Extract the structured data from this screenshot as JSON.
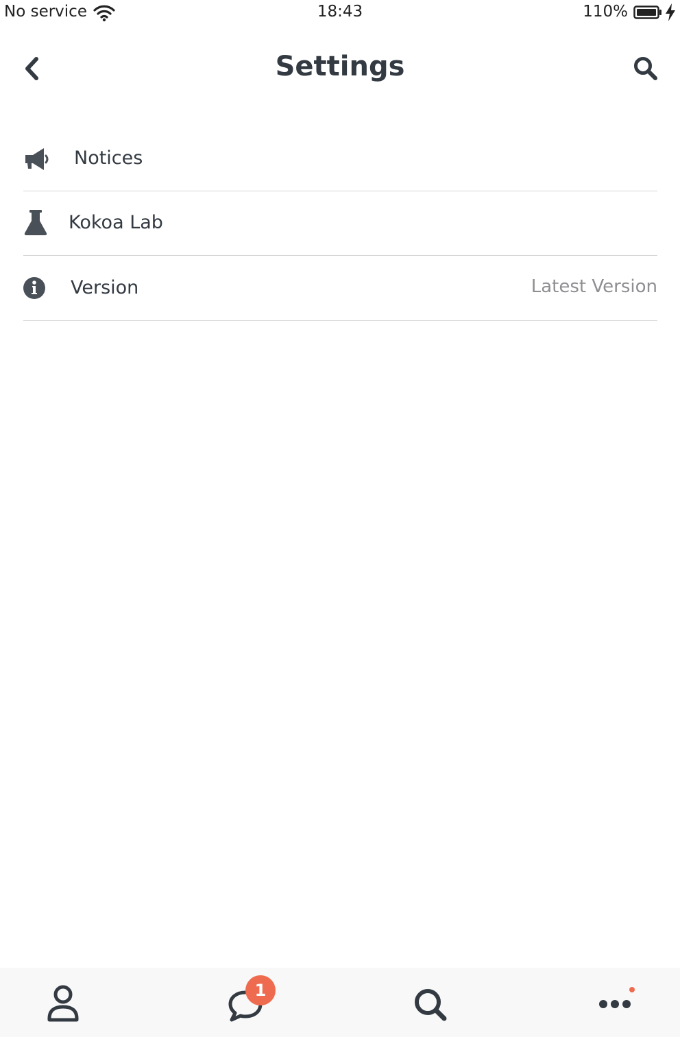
{
  "status_bar": {
    "carrier": "No service",
    "time": "18:43",
    "battery_percent": "110%",
    "icons": [
      "wifi-icon",
      "battery-icon",
      "charging-bolt-icon"
    ]
  },
  "nav": {
    "title": "Settings",
    "back_icon": "chevron-left-icon",
    "search_icon": "search-icon"
  },
  "settings": {
    "items": [
      {
        "icon": "megaphone-icon",
        "label": "Notices",
        "value": ""
      },
      {
        "icon": "flask-icon",
        "label": "Kokoa Lab",
        "value": ""
      },
      {
        "icon": "info-circle-icon",
        "label": "Version",
        "value": "Latest Version"
      }
    ]
  },
  "tab_bar": {
    "tabs": [
      {
        "icon": "person-icon"
      },
      {
        "icon": "chat-bubble-icon",
        "badge": "1"
      },
      {
        "icon": "search-icon"
      },
      {
        "icon": "more-dots-icon",
        "has_dot": true
      }
    ]
  },
  "colors": {
    "text_primary": "#333a42",
    "text_secondary": "#8e8e93",
    "divider": "#d6d6d6",
    "badge": "#ef6b4f",
    "tab_bar_bg": "#f8f8f8"
  }
}
